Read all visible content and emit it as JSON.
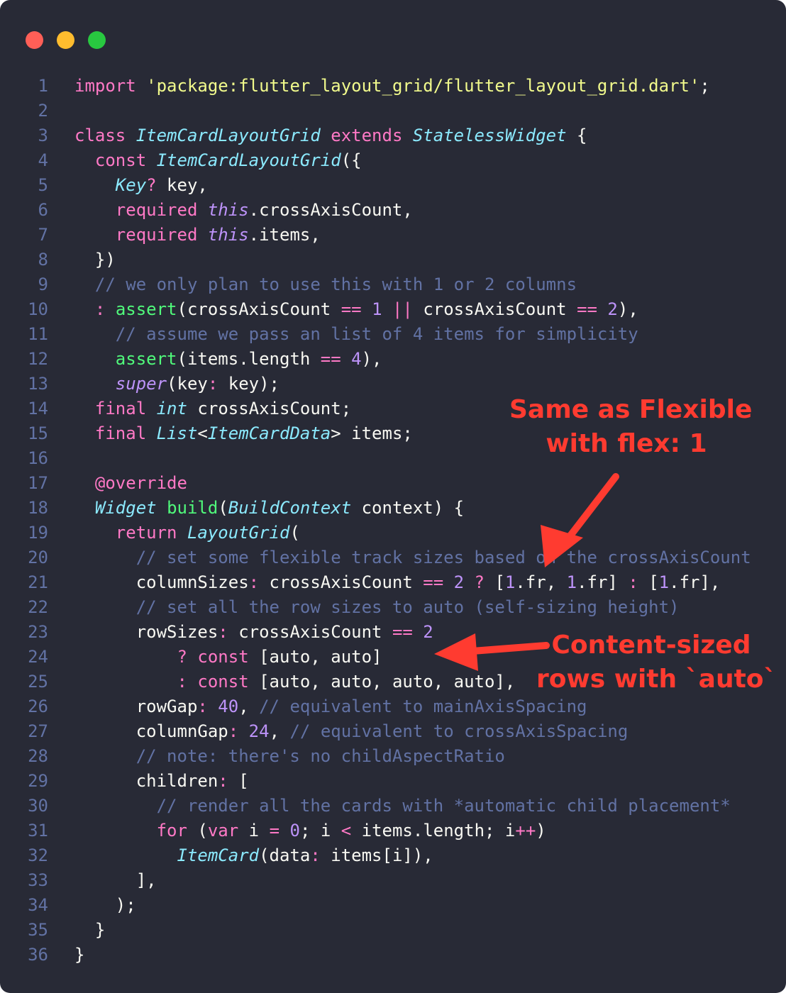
{
  "window": {
    "traffic_lights": [
      {
        "name": "close",
        "color": "#ff5f57"
      },
      {
        "name": "minimize",
        "color": "#febc2e"
      },
      {
        "name": "zoom",
        "color": "#28c840"
      }
    ]
  },
  "code_lines": [
    {
      "n": "1",
      "tokens": [
        [
          "kw",
          "import "
        ],
        [
          "str",
          "'package:flutter_layout_grid/flutter_layout_grid.dart'"
        ],
        [
          "pl",
          ";"
        ]
      ]
    },
    {
      "n": "2",
      "tokens": []
    },
    {
      "n": "3",
      "tokens": [
        [
          "kw",
          "class "
        ],
        [
          "ty",
          "ItemCardLayoutGrid "
        ],
        [
          "kw",
          "extends "
        ],
        [
          "ty",
          "StatelessWidget "
        ],
        [
          "pl",
          "{"
        ]
      ]
    },
    {
      "n": "4",
      "tokens": [
        [
          "pl",
          "  "
        ],
        [
          "kw",
          "const "
        ],
        [
          "ty",
          "ItemCardLayoutGrid"
        ],
        [
          "pl",
          "({"
        ]
      ]
    },
    {
      "n": "5",
      "tokens": [
        [
          "pl",
          "    "
        ],
        [
          "ty",
          "Key"
        ],
        [
          "kw",
          "?"
        ],
        [
          "pl",
          " key,"
        ]
      ]
    },
    {
      "n": "6",
      "tokens": [
        [
          "pl",
          "    "
        ],
        [
          "kw",
          "required "
        ],
        [
          "it",
          "this"
        ],
        [
          "pl",
          ".crossAxisCount,"
        ]
      ]
    },
    {
      "n": "7",
      "tokens": [
        [
          "pl",
          "    "
        ],
        [
          "kw",
          "required "
        ],
        [
          "it",
          "this"
        ],
        [
          "pl",
          ".items,"
        ]
      ]
    },
    {
      "n": "8",
      "tokens": [
        [
          "pl",
          "  })"
        ]
      ]
    },
    {
      "n": "9",
      "tokens": [
        [
          "cm",
          "  // we only plan to use this with 1 or 2 columns"
        ]
      ]
    },
    {
      "n": "10",
      "tokens": [
        [
          "pl",
          "  "
        ],
        [
          "kw",
          ": "
        ],
        [
          "fn",
          "assert"
        ],
        [
          "pl",
          "(crossAxisCount "
        ],
        [
          "kw",
          "=="
        ],
        [
          "pl",
          " "
        ],
        [
          "num",
          "1"
        ],
        [
          "pl",
          " "
        ],
        [
          "kw",
          "||"
        ],
        [
          "pl",
          " crossAxisCount "
        ],
        [
          "kw",
          "=="
        ],
        [
          "pl",
          " "
        ],
        [
          "num",
          "2"
        ],
        [
          "pl",
          "),"
        ]
      ]
    },
    {
      "n": "11",
      "tokens": [
        [
          "cm",
          "    // assume we pass an list of 4 items for simplicity"
        ]
      ]
    },
    {
      "n": "12",
      "tokens": [
        [
          "pl",
          "    "
        ],
        [
          "fn",
          "assert"
        ],
        [
          "pl",
          "(items.length "
        ],
        [
          "kw",
          "=="
        ],
        [
          "pl",
          " "
        ],
        [
          "num",
          "4"
        ],
        [
          "pl",
          "),"
        ]
      ]
    },
    {
      "n": "13",
      "tokens": [
        [
          "pl",
          "    "
        ],
        [
          "it",
          "super"
        ],
        [
          "pl",
          "(key"
        ],
        [
          "kw",
          ":"
        ],
        [
          "pl",
          " key);"
        ]
      ]
    },
    {
      "n": "14",
      "tokens": [
        [
          "pl",
          "  "
        ],
        [
          "kw",
          "final "
        ],
        [
          "ty",
          "int"
        ],
        [
          "pl",
          " crossAxisCount;"
        ]
      ]
    },
    {
      "n": "15",
      "tokens": [
        [
          "pl",
          "  "
        ],
        [
          "kw",
          "final "
        ],
        [
          "ty",
          "List"
        ],
        [
          "pl",
          "<"
        ],
        [
          "ty",
          "ItemCardData"
        ],
        [
          "pl",
          "> items;"
        ]
      ]
    },
    {
      "n": "16",
      "tokens": []
    },
    {
      "n": "17",
      "tokens": [
        [
          "pl",
          "  "
        ],
        [
          "kw",
          "@override"
        ]
      ]
    },
    {
      "n": "18",
      "tokens": [
        [
          "pl",
          "  "
        ],
        [
          "ty",
          "Widget"
        ],
        [
          "pl",
          " "
        ],
        [
          "fn",
          "build"
        ],
        [
          "pl",
          "("
        ],
        [
          "ty",
          "BuildContext"
        ],
        [
          "pl",
          " context) {"
        ]
      ]
    },
    {
      "n": "19",
      "tokens": [
        [
          "pl",
          "    "
        ],
        [
          "kw",
          "return "
        ],
        [
          "ty",
          "LayoutGrid"
        ],
        [
          "pl",
          "("
        ]
      ]
    },
    {
      "n": "20",
      "tokens": [
        [
          "cm",
          "      // set some flexible track sizes based on the crossAxisCount"
        ]
      ]
    },
    {
      "n": "21",
      "tokens": [
        [
          "pl",
          "      columnSizes"
        ],
        [
          "kw",
          ":"
        ],
        [
          "pl",
          " crossAxisCount "
        ],
        [
          "kw",
          "=="
        ],
        [
          "pl",
          " "
        ],
        [
          "num",
          "2"
        ],
        [
          "pl",
          " "
        ],
        [
          "kw",
          "?"
        ],
        [
          "pl",
          " ["
        ],
        [
          "num",
          "1"
        ],
        [
          "pl",
          ".fr, "
        ],
        [
          "num",
          "1"
        ],
        [
          "pl",
          ".fr] "
        ],
        [
          "kw",
          ":"
        ],
        [
          "pl",
          " ["
        ],
        [
          "num",
          "1"
        ],
        [
          "pl",
          ".fr],"
        ]
      ]
    },
    {
      "n": "22",
      "tokens": [
        [
          "cm",
          "      // set all the row sizes to auto (self-sizing height)"
        ]
      ]
    },
    {
      "n": "23",
      "tokens": [
        [
          "pl",
          "      rowSizes"
        ],
        [
          "kw",
          ":"
        ],
        [
          "pl",
          " crossAxisCount "
        ],
        [
          "kw",
          "=="
        ],
        [
          "pl",
          " "
        ],
        [
          "num",
          "2"
        ]
      ]
    },
    {
      "n": "24",
      "tokens": [
        [
          "pl",
          "          "
        ],
        [
          "kw",
          "?"
        ],
        [
          "pl",
          " "
        ],
        [
          "kw",
          "const"
        ],
        [
          "pl",
          " [auto, auto]"
        ]
      ]
    },
    {
      "n": "25",
      "tokens": [
        [
          "pl",
          "          "
        ],
        [
          "kw",
          ":"
        ],
        [
          "pl",
          " "
        ],
        [
          "kw",
          "const"
        ],
        [
          "pl",
          " [auto, auto, auto, auto],"
        ]
      ]
    },
    {
      "n": "26",
      "tokens": [
        [
          "pl",
          "      rowGap"
        ],
        [
          "kw",
          ":"
        ],
        [
          "pl",
          " "
        ],
        [
          "num",
          "40"
        ],
        [
          "pl",
          ", "
        ],
        [
          "cm",
          "// equivalent to mainAxisSpacing"
        ]
      ]
    },
    {
      "n": "27",
      "tokens": [
        [
          "pl",
          "      columnGap"
        ],
        [
          "kw",
          ":"
        ],
        [
          "pl",
          " "
        ],
        [
          "num",
          "24"
        ],
        [
          "pl",
          ", "
        ],
        [
          "cm",
          "// equivalent to crossAxisSpacing"
        ]
      ]
    },
    {
      "n": "28",
      "tokens": [
        [
          "cm",
          "      // note: there's no childAspectRatio"
        ]
      ]
    },
    {
      "n": "29",
      "tokens": [
        [
          "pl",
          "      children"
        ],
        [
          "kw",
          ":"
        ],
        [
          "pl",
          " ["
        ]
      ]
    },
    {
      "n": "30",
      "tokens": [
        [
          "cm",
          "        // render all the cards with *automatic child placement*"
        ]
      ]
    },
    {
      "n": "31",
      "tokens": [
        [
          "pl",
          "        "
        ],
        [
          "kw",
          "for"
        ],
        [
          "pl",
          " ("
        ],
        [
          "kw",
          "var"
        ],
        [
          "pl",
          " i "
        ],
        [
          "kw",
          "="
        ],
        [
          "pl",
          " "
        ],
        [
          "num",
          "0"
        ],
        [
          "pl",
          "; i "
        ],
        [
          "kw",
          "<"
        ],
        [
          "pl",
          " items.length; i"
        ],
        [
          "kw",
          "++"
        ],
        [
          "pl",
          ")"
        ]
      ]
    },
    {
      "n": "32",
      "tokens": [
        [
          "pl",
          "          "
        ],
        [
          "ty",
          "ItemCard"
        ],
        [
          "pl",
          "(data"
        ],
        [
          "kw",
          ":"
        ],
        [
          "pl",
          " items[i]),"
        ]
      ]
    },
    {
      "n": "33",
      "tokens": [
        [
          "pl",
          "      ],"
        ]
      ]
    },
    {
      "n": "34",
      "tokens": [
        [
          "pl",
          "    );"
        ]
      ]
    },
    {
      "n": "35",
      "tokens": [
        [
          "pl",
          "  }"
        ]
      ]
    },
    {
      "n": "36",
      "tokens": [
        [
          "pl",
          "}"
        ]
      ]
    }
  ],
  "annotations": {
    "flexible": "Same as Flexible\nwith flex: 1",
    "auto_rows": "Content-sized\nrows with `auto`",
    "color": "#ff3b30"
  }
}
